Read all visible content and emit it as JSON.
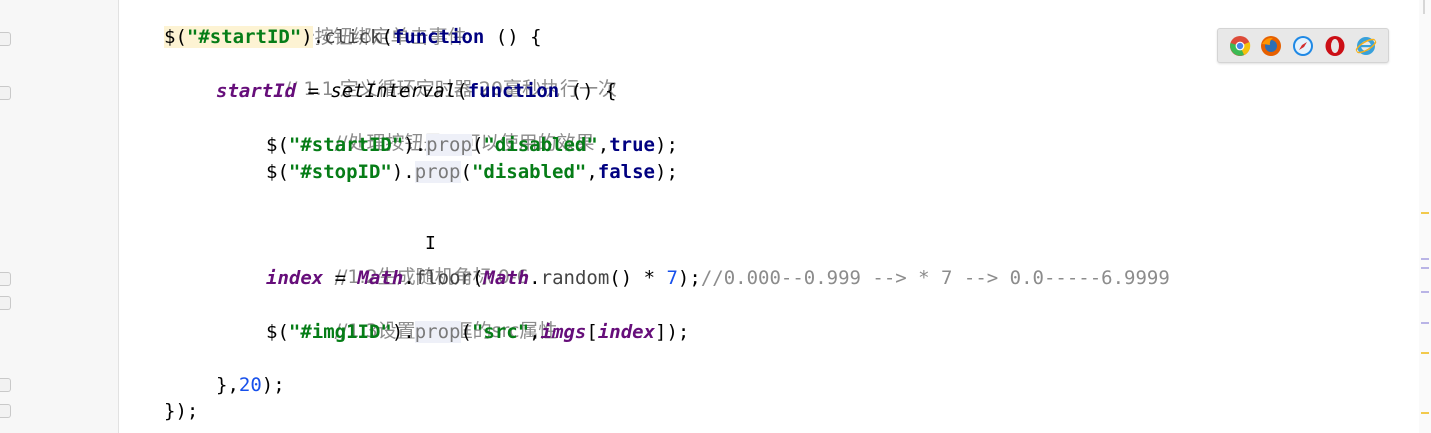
{
  "code": {
    "line1": {
      "comment": "//1. 给开始按钮绑定单击事件"
    },
    "line2": {
      "dollar": "$(",
      "selector": "\"#startID\"",
      "close": ")",
      "dot": ".",
      "method": "click",
      "open": "(",
      "kw": "function",
      "rest": " () {"
    },
    "line3": {
      "comment": "// 1.1 定义循环定时器 20毫秒执行一次"
    },
    "line4": {
      "var": "startId",
      "eq": " = ",
      "fn": "setInterval",
      "open": "(",
      "kw": "function",
      "rest": " () {"
    },
    "line5": {
      "comment": "//处理按钮是否可以使用的效果"
    },
    "line6": {
      "dollar": "$(",
      "selector": "\"#startID\"",
      "close": ").",
      "method": "prop",
      "open": "(",
      "arg1": "\"disabled\"",
      "comma": ",",
      "arg2": "true",
      "end": ");"
    },
    "line7": {
      "dollar": "$(",
      "selector": "\"#stopID\"",
      "close": ").",
      "method": "prop",
      "open": "(",
      "arg1": "\"disabled\"",
      "comma": ",",
      "arg2": "false",
      "end": ");"
    },
    "line8": {
      "comment": "//1.2生成随机角标 0-6"
    },
    "line9": {
      "var": "index",
      "eq": " = ",
      "obj1": "Math",
      "dot1": ".",
      "m1": "floor",
      "open1": "(",
      "obj2": "Math",
      "dot2": ".",
      "m2": "random",
      "call": "() * ",
      "num": "7",
      "end": ");",
      "comment": "//0.000--0.999 --> * 7 --> 0.0-----6.9999"
    },
    "line10": {
      "comment": "//1.3设置小相框的src属性"
    },
    "line11": {
      "dollar": "$(",
      "selector": "\"#img1ID\"",
      "close": ").",
      "method": "prop",
      "open": "(",
      "arg1": "\"src\"",
      "comma": ",",
      "arr": "imgs",
      "br1": "[",
      "idx": "index",
      "end": "]);"
    },
    "line12": {
      "close": "},",
      "num": "20",
      "end": ");"
    },
    "line13": {
      "text": "});"
    }
  },
  "cursor_glyph": "I",
  "browsers": [
    {
      "name": "chrome-icon",
      "color": "#dd4b39"
    },
    {
      "name": "firefox-icon",
      "color": "#e66000"
    },
    {
      "name": "safari-icon",
      "color": "#1e88e5"
    },
    {
      "name": "opera-icon",
      "color": "#cc0f16"
    },
    {
      "name": "ie-icon",
      "color": "#38a1db"
    }
  ],
  "colors": {
    "string": "#067d17",
    "keyword": "#000080",
    "variable": "#660e7a",
    "number": "#1750eb",
    "comment": "#8c8c8c"
  }
}
